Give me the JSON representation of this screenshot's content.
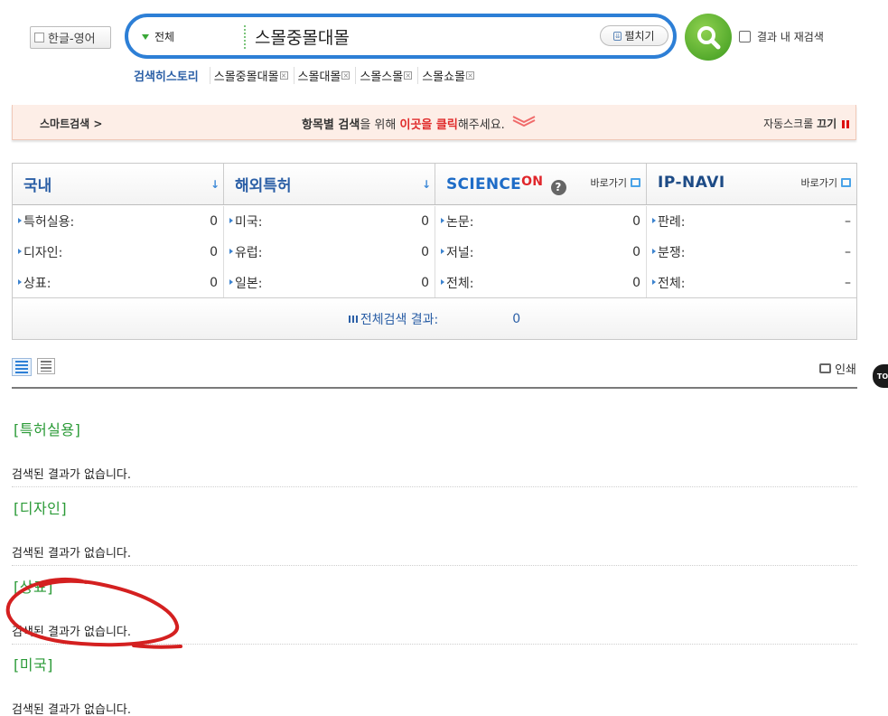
{
  "lang_toggle": {
    "label": "한글-영어"
  },
  "search": {
    "scope": "전체",
    "query": "스몰중몰대몰",
    "expand_label": "펼치기",
    "recheck_label": "결과 내 재검색"
  },
  "history": {
    "label": "검색히스토리",
    "items": [
      "스몰중몰대몰",
      "스몰대몰",
      "스몰스몰",
      "스몰쇼몰"
    ]
  },
  "smart": {
    "left": "스마트검색 >",
    "center_pre": "항목별 검색",
    "center_mid1": "을 위해 ",
    "center_red": "이곳을 클릭",
    "center_post": "해주세요.",
    "right_pre": "자동스크롤 ",
    "right_bold": "끄기"
  },
  "panel": {
    "col1": {
      "title": "국내"
    },
    "col2": {
      "title": "해외특허"
    },
    "col3": {
      "logo": "SCIENCE",
      "logo_on": "ON",
      "help": "?",
      "goto": "바로가기"
    },
    "col4": {
      "logo": "IP-NAVI",
      "goto": "바로가기"
    },
    "rows": [
      [
        {
          "label": "특허실용:",
          "value": "0"
        },
        {
          "label": "미국:",
          "value": "0"
        },
        {
          "label": "논문:",
          "value": "0"
        },
        {
          "label": "판례:",
          "value": "–"
        }
      ],
      [
        {
          "label": "디자인:",
          "value": "0"
        },
        {
          "label": "유럽:",
          "value": "0"
        },
        {
          "label": "저널:",
          "value": "0"
        },
        {
          "label": "분쟁:",
          "value": "–"
        }
      ],
      [
        {
          "label": "상표:",
          "value": "0"
        },
        {
          "label": "일본:",
          "value": "0"
        },
        {
          "label": "전체:",
          "value": "0"
        },
        {
          "label": "전체:",
          "value": "–"
        }
      ]
    ],
    "total_label": "전체검색 결과:",
    "total_value": "0"
  },
  "print_label": "인쇄",
  "top_label": "TO",
  "sections": [
    {
      "title": "[특허실용]",
      "message": "검색된 결과가 없습니다."
    },
    {
      "title": "[디자인]",
      "message": "검색된 결과가 없습니다."
    },
    {
      "title": "[상표]",
      "message": "검색된 결과가 없습니다."
    },
    {
      "title": "[미국]",
      "message": "검색된 결과가 없습니다."
    }
  ],
  "colors": {
    "accent_blue": "#2d7fd6",
    "section_green": "#2a9a36",
    "annotation_red": "#d42020"
  }
}
